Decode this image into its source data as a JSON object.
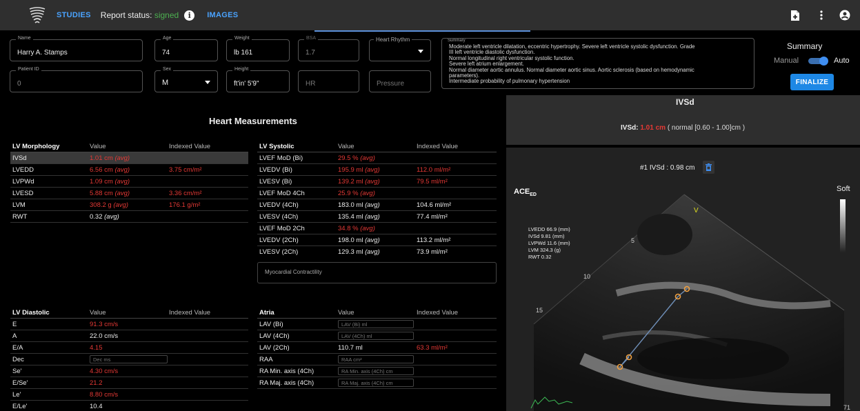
{
  "topbar": {
    "studies_label": "STUDIES",
    "report_label": "Report status:",
    "report_status": "signed",
    "info_glyph": "i",
    "images_label": "IMAGES",
    "icons": [
      "logo-icon",
      "info-icon",
      "add-document-icon",
      "more-vert-icon",
      "account-icon"
    ]
  },
  "patient": {
    "name": {
      "label": "Name",
      "value": "Harry A. Stamps"
    },
    "age": {
      "label": "Age",
      "value": "74"
    },
    "weight": {
      "label": "Weight",
      "value": "lb  161"
    },
    "bsa": {
      "label": "BSA",
      "value": "1.7"
    },
    "heart_rhythm": {
      "label": "Heart Rhythm",
      "value": ""
    },
    "patient_id": {
      "label": "Patient ID",
      "value": "0"
    },
    "sex": {
      "label": "Sex",
      "value": "M"
    },
    "height": {
      "label": "Height",
      "value": "ft'in'  5'9\""
    },
    "hr": {
      "placeholder": "HR"
    },
    "pressure": {
      "placeholder": "Pressure"
    }
  },
  "summary": {
    "label": "Summary",
    "lines": [
      "Moderate left ventricle dilatation, eccentric hypertrophy. Severe left ventricle systolic dysfunction. Grade",
      "III left ventricle diastolic dysfunction.",
      "Normal longitudinal right ventricular systolic function.",
      "Severe left atrium enlargement.",
      "Normal diameter aortic annulus. Normal diameter aortic sinus. Aortic sclerosis (based on hemodynamic",
      "parameters).",
      "Intermediate probability of pulmonary hypertension"
    ],
    "panel_title": "Summary",
    "manual_label": "Manual",
    "auto_label": "Auto",
    "auto_enabled": true,
    "finalize_label": "FINALIZE"
  },
  "measurements": {
    "title": "Heart Measurements",
    "lv_morphology": {
      "headers": [
        "LV Morphology",
        "Value",
        "Indexed Value"
      ],
      "rows": [
        {
          "name": "IVSd",
          "value": "1.01 cm",
          "suffix": "(avg)",
          "indexed": "",
          "abnormal": true,
          "selected": true
        },
        {
          "name": "LVEDD",
          "value": "6.56 cm",
          "suffix": "(avg)",
          "indexed": "3.75 cm/m²",
          "abnormal": true
        },
        {
          "name": "LVPWd",
          "value": "1.09 cm",
          "suffix": "(avg)",
          "indexed": "",
          "abnormal": true
        },
        {
          "name": "LVESD",
          "value": "5.88 cm",
          "suffix": "(avg)",
          "indexed": "3.36 cm/m²",
          "abnormal": true
        },
        {
          "name": "LVM",
          "value": "308.2 g",
          "suffix": "(avg)",
          "indexed": "176.1 g/m²",
          "abnormal": true
        },
        {
          "name": "RWT",
          "value": "0.32",
          "suffix": "(avg)",
          "indexed": "",
          "abnormal": false
        }
      ]
    },
    "lv_systolic": {
      "headers": [
        "LV Systolic",
        "Value",
        "Indexed Value"
      ],
      "rows": [
        {
          "name": "LVEF MoD (Bi)",
          "value": "29.5 %",
          "suffix": "(avg)",
          "indexed": "",
          "abnormal": true
        },
        {
          "name": "LVEDV (Bi)",
          "value": "195.9 ml",
          "suffix": "(avg)",
          "indexed": "112.0 ml/m²",
          "abnormal": true
        },
        {
          "name": "LVESV (Bi)",
          "value": "139.2 ml",
          "suffix": "(avg)",
          "indexed": "79.5 ml/m²",
          "abnormal": true
        },
        {
          "name": "LVEF MoD 4Ch",
          "value": "25.9 %",
          "suffix": "(avg)",
          "indexed": "",
          "abnormal": true
        },
        {
          "name": "LVEDV (4Ch)",
          "value": "183.0 ml",
          "suffix": "(avg)",
          "indexed": "104.6 ml/m²",
          "abnormal": false
        },
        {
          "name": "LVESV (4Ch)",
          "value": "135.4 ml",
          "suffix": "(avg)",
          "indexed": "77.4 ml/m²",
          "abnormal": false
        },
        {
          "name": "LVEF MoD 2Ch",
          "value": "34.8 %",
          "suffix": "(avg)",
          "indexed": "",
          "abnormal": true
        },
        {
          "name": "LVEDV (2Ch)",
          "value": "198.0 ml",
          "suffix": "(avg)",
          "indexed": "113.2 ml/m²",
          "abnormal": false
        },
        {
          "name": "LVESV (2Ch)",
          "value": "129.3 ml",
          "suffix": "(avg)",
          "indexed": "73.9 ml/m²",
          "abnormal": false
        }
      ],
      "contractility_placeholder": "Myocardial Contractility"
    },
    "lv_diastolic": {
      "headers": [
        "LV Diastolic",
        "Value",
        "Indexed Value"
      ],
      "rows": [
        {
          "name": "E",
          "value": "91.3 cm/s",
          "abnormal": true
        },
        {
          "name": "A",
          "value": "22.0 cm/s",
          "abnormal": false
        },
        {
          "name": "E/A",
          "value": "4.15",
          "abnormal": true
        },
        {
          "name": "Dec",
          "value": "",
          "placeholder": "Dec ms",
          "input": true
        },
        {
          "name": "Se'",
          "value": "4.30 cm/s",
          "abnormal": true
        },
        {
          "name": "E/Se'",
          "value": "21.2",
          "abnormal": true
        },
        {
          "name": "Le'",
          "value": "8.80 cm/s",
          "abnormal": true
        },
        {
          "name": "E/Le'",
          "value": "10.4",
          "abnormal": false
        }
      ]
    },
    "atria": {
      "headers": [
        "Atria",
        "Value",
        "Indexed Value"
      ],
      "rows": [
        {
          "name": "LAV (Bi)",
          "placeholder": "LAV (Bi) ml",
          "input": true
        },
        {
          "name": "LAV (4Ch)",
          "placeholder": "LAV (4Ch) ml",
          "input": true
        },
        {
          "name": "LAV (2Ch)",
          "value": "110.7 ml",
          "indexed": "63.3 ml/m²",
          "abnormal": false,
          "indexed_abnormal": true
        },
        {
          "name": "RAA",
          "placeholder": "RAA cm²",
          "input": true
        },
        {
          "name": "RA Min. axis (4Ch)",
          "placeholder": "RA Min. axis (4Ch) cm",
          "input": true
        },
        {
          "name": "RA Maj. axis (4Ch)",
          "placeholder": "RA Maj. axis (4Ch) cm",
          "input": true
        }
      ]
    }
  },
  "viewer": {
    "title": "IVSd",
    "result_label": "IVSd:",
    "result_value": "1.01 cm",
    "result_range": "( normal [0.60 - 1.00]cm )",
    "measurement_item": "#1 IVSd : 0.98 cm",
    "view_label": "ACE",
    "view_sub": "ED",
    "preset_label": "Soft",
    "overlay_lines": [
      "LVEDD 66.9 (mm)",
      "IVSd 9.81 (mm)",
      "LVPWd 11.6 (mm)",
      "LVM 324.3 (g)",
      "RWT 0.32"
    ],
    "depth_marks": [
      "5",
      "10",
      "15"
    ],
    "frame_number": "71",
    "colors": {
      "abnormal": "#e53935",
      "accent": "#1e88e5",
      "caliper": "#f0a040",
      "signed": "#4caf50"
    }
  }
}
